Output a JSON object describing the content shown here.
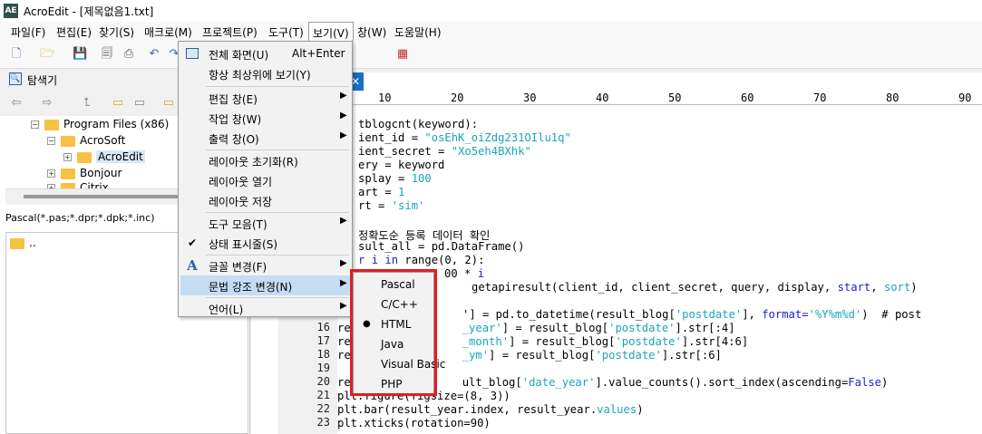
{
  "window": {
    "title": "AcroEdit - [제목없음1.txt]",
    "app_icon": "AE"
  },
  "menubar": [
    "파일(F)",
    "편집(E)",
    "찾기(S)",
    "매크로(M)",
    "프로젝트(P)",
    "도구(T)",
    "보기(V)",
    "창(W)",
    "도움말(H)"
  ],
  "explorer": {
    "title": "탐색기",
    "tree": [
      {
        "label": "Program Files (x86)",
        "expander": "⊟"
      },
      {
        "label": "AcroSoft",
        "expander": "⊟"
      },
      {
        "label": "AcroEdit",
        "expander": "⊞"
      },
      {
        "label": "Bonjour",
        "expander": "⊞"
      },
      {
        "label": "Citrix",
        "expander": "⊞"
      }
    ],
    "filter": "Pascal(*.pas;*.dpr;*.dpk;*.inc)",
    "file_list": [
      ".."
    ]
  },
  "ruler": [
    "10",
    "20",
    "30",
    "40",
    "50",
    "60",
    "70",
    "80",
    "90"
  ],
  "view_menu": {
    "items": [
      {
        "label": "전체 화면(U)",
        "shortcut": "Alt+Enter",
        "icon": "fullscreen-icon"
      },
      {
        "label": "항상 최상위에 보기(Y)"
      },
      {
        "label": "편집 창(E)",
        "submenu": true
      },
      {
        "label": "작업 창(W)",
        "submenu": true
      },
      {
        "label": "출력 창(O)",
        "submenu": true
      },
      {
        "label": "레이아웃 초기화(R)"
      },
      {
        "label": "레이아웃 열기"
      },
      {
        "label": "레이아웃 저장"
      },
      {
        "label": "도구 모음(T)",
        "submenu": true
      },
      {
        "label": "상태 표시줄(S)",
        "checked": true
      },
      {
        "label": "글꼴 변경(F)",
        "submenu": true,
        "icon": "font-icon"
      },
      {
        "label": "문법 강조 변경(N)",
        "submenu": true,
        "highlighted": true
      },
      {
        "label": "언어(L)",
        "submenu": true
      }
    ],
    "arrow": "▶",
    "check": "✔",
    "font_glyph": "A"
  },
  "syntax_submenu": {
    "items": [
      "Pascal",
      "C/C++",
      "HTML",
      "Java",
      "Visual Basic",
      "PHP"
    ],
    "selected": "HTML",
    "bullet": "●"
  },
  "line_numbers": [
    "16",
    "17",
    "18",
    "19",
    "20",
    "21",
    "22",
    "23"
  ],
  "code": {
    "l1": "tblogcnt(keyword):",
    "l2a": "ient_id = ",
    "l2b": "\"osEhK_oiZdg231OIlu1q\"",
    "l3a": "ient_secret = ",
    "l3b": "\"Xo5eh4BXhk\"",
    "l4": "ery = keyword",
    "l5a": "splay = ",
    "l5b": "100",
    "l6a": "art = ",
    "l6b": "1",
    "l7a": "rt = ",
    "l7b": "'sim'",
    "l9": "정확도순 등록 데이터 확인",
    "l10": "sult_all = pd.DataFrame()",
    "l11a": "r ",
    "l11b": "i",
    "l11c": " in",
    "l11d": " range(0, 2):",
    "l12a": "00 * ",
    "l12b": "i",
    "l13a": "getapiresult(client_id, client_secret, query, display, ",
    "l13b": "start",
    "l13c": ", ",
    "l13d": "sort",
    "l13e": ")",
    "l15a": "'] = pd.to_datetime(result_blog[",
    "l15b": "'postdate'",
    "l15c": "], ",
    "l15d": "format=",
    "l15e": "'%Y%m%d'",
    "l15f": ")  # post",
    "l16a": "re",
    "l16b": "_year'",
    "l16c": "] = result_blog[",
    "l16d": "'postdate'",
    "l16e": "].str[:4]",
    "l17a": "re",
    "l17b": "_month'",
    "l17c": "] = result_blog[",
    "l17d": "'postdate'",
    "l17e": "].str[4:6]",
    "l18a": "re",
    "l18b": "_ym'",
    "l18c": "] = result_blog[",
    "l18d": "'postdate'",
    "l18e": "].str[:6]",
    "l20a": "re",
    "l20b": "ult_blog[",
    "l20c": "'date_year'",
    "l20d": "].value_counts().sort_index(ascending=",
    "l20e": "False",
    "l20f": ")",
    "l21": "plt.figure(figsize=(8, 3))",
    "l22a": "plt.bar(result_year.index, result_year.",
    "l22b": "values",
    "l22c": ")",
    "l23": "plt.xticks(rotation=90)"
  }
}
